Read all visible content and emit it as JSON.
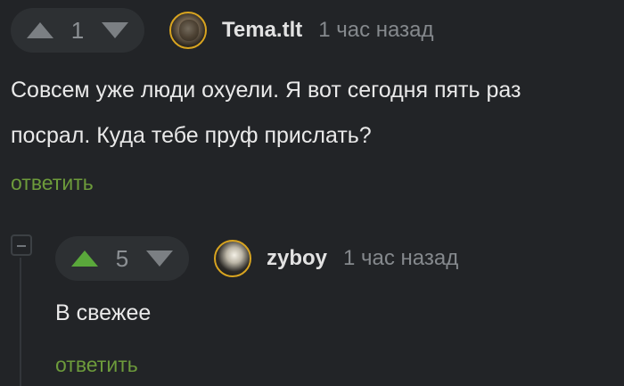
{
  "colors": {
    "background": "#222427",
    "vote_pill": "#2d3033",
    "upvote_active": "#5aa83b",
    "reply_link": "#6d9b3b",
    "avatar_border": "#d8a420"
  },
  "comments": [
    {
      "rating": "1",
      "upvoted": false,
      "username": "Tema.tlt",
      "timestamp": "1 час назад",
      "text_lines": [
        "Совсем уже люди охуели. Я вот сегодня пять раз",
        "посрал. Куда тебе пруф прислать?"
      ],
      "reply_label": "ответить"
    },
    {
      "rating": "5",
      "upvoted": true,
      "username": "zyboy",
      "timestamp": "1 час назад",
      "text_lines": [
        "В свежее"
      ],
      "reply_label": "ответить"
    }
  ]
}
